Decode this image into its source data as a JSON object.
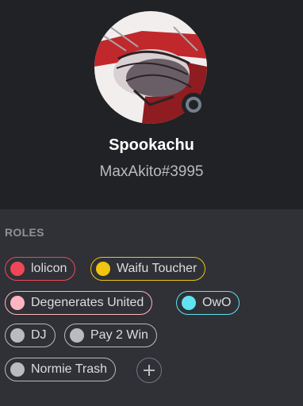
{
  "profile": {
    "display_name": "Spookachu",
    "username": "MaxAkito#3995",
    "status": "offline"
  },
  "roles_section": {
    "label": "ROLES",
    "add_icon": "plus-icon"
  },
  "roles": [
    {
      "name": "lolicon",
      "color": "#f04757"
    },
    {
      "name": "Waifu Toucher",
      "color": "#f1c40f"
    },
    {
      "name": "Degenerates United",
      "color": "#ffb6c1"
    },
    {
      "name": "OwO",
      "color": "#5fe3f0"
    },
    {
      "name": "DJ",
      "color": "#b9bbbe"
    },
    {
      "name": "Pay 2 Win",
      "color": "#b9bbbe"
    },
    {
      "name": "Normie Trash",
      "color": "#b9bbbe"
    }
  ],
  "colors": {
    "header_bg": "#202225",
    "panel_bg": "#2f3136",
    "offline_status": "#747f8d"
  }
}
